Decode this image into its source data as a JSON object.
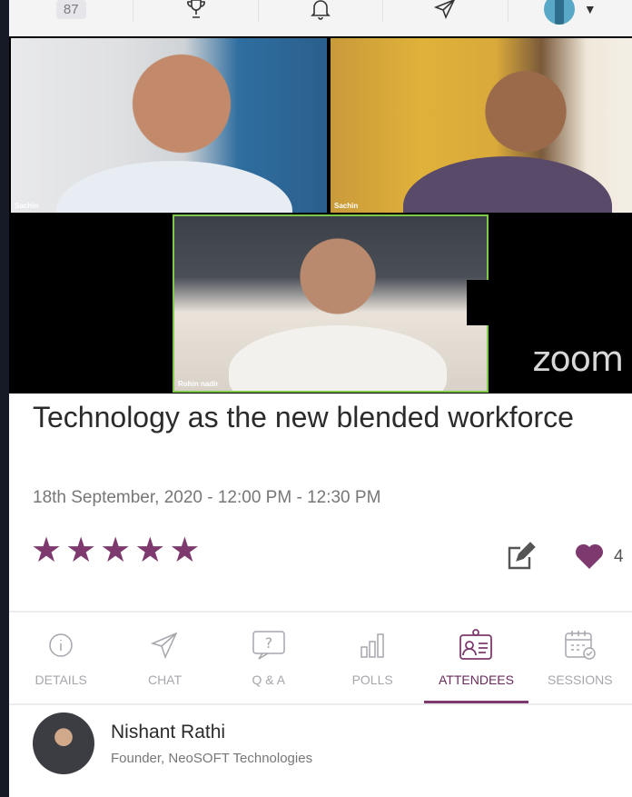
{
  "topbar": {
    "count": "87",
    "icons": [
      "trophy-icon",
      "bell-icon",
      "send-icon",
      "avatar",
      "chevron-down-icon"
    ]
  },
  "video": {
    "participants": [
      {
        "name": "Sachin"
      },
      {
        "name": "Sachin"
      },
      {
        "name": "Rohin nadir"
      }
    ],
    "brand": "zoom"
  },
  "session": {
    "title": "Technology as the new blended workforce",
    "datetime": "18th September, 2020 - 12:00 PM - 12:30 PM",
    "rating": 5,
    "likes": "4"
  },
  "tabs": [
    {
      "label": "DETAILS",
      "icon": "info-icon",
      "active": false
    },
    {
      "label": "CHAT",
      "icon": "send-icon",
      "active": false
    },
    {
      "label": "Q & A",
      "icon": "question-bubble-icon",
      "active": false
    },
    {
      "label": "POLLS",
      "icon": "bar-chart-icon",
      "active": false
    },
    {
      "label": "ATTENDEES",
      "icon": "contact-card-icon",
      "active": true
    },
    {
      "label": "SESSIONS",
      "icon": "calendar-check-icon",
      "active": false
    }
  ],
  "attendee": {
    "name": "Nishant Rathi",
    "role": "Founder, NeoSOFT Technologies"
  },
  "colors": {
    "accent": "#7e3a6e",
    "tab_inactive": "#a6a6ad",
    "speaker_border": "#7ec84a"
  }
}
